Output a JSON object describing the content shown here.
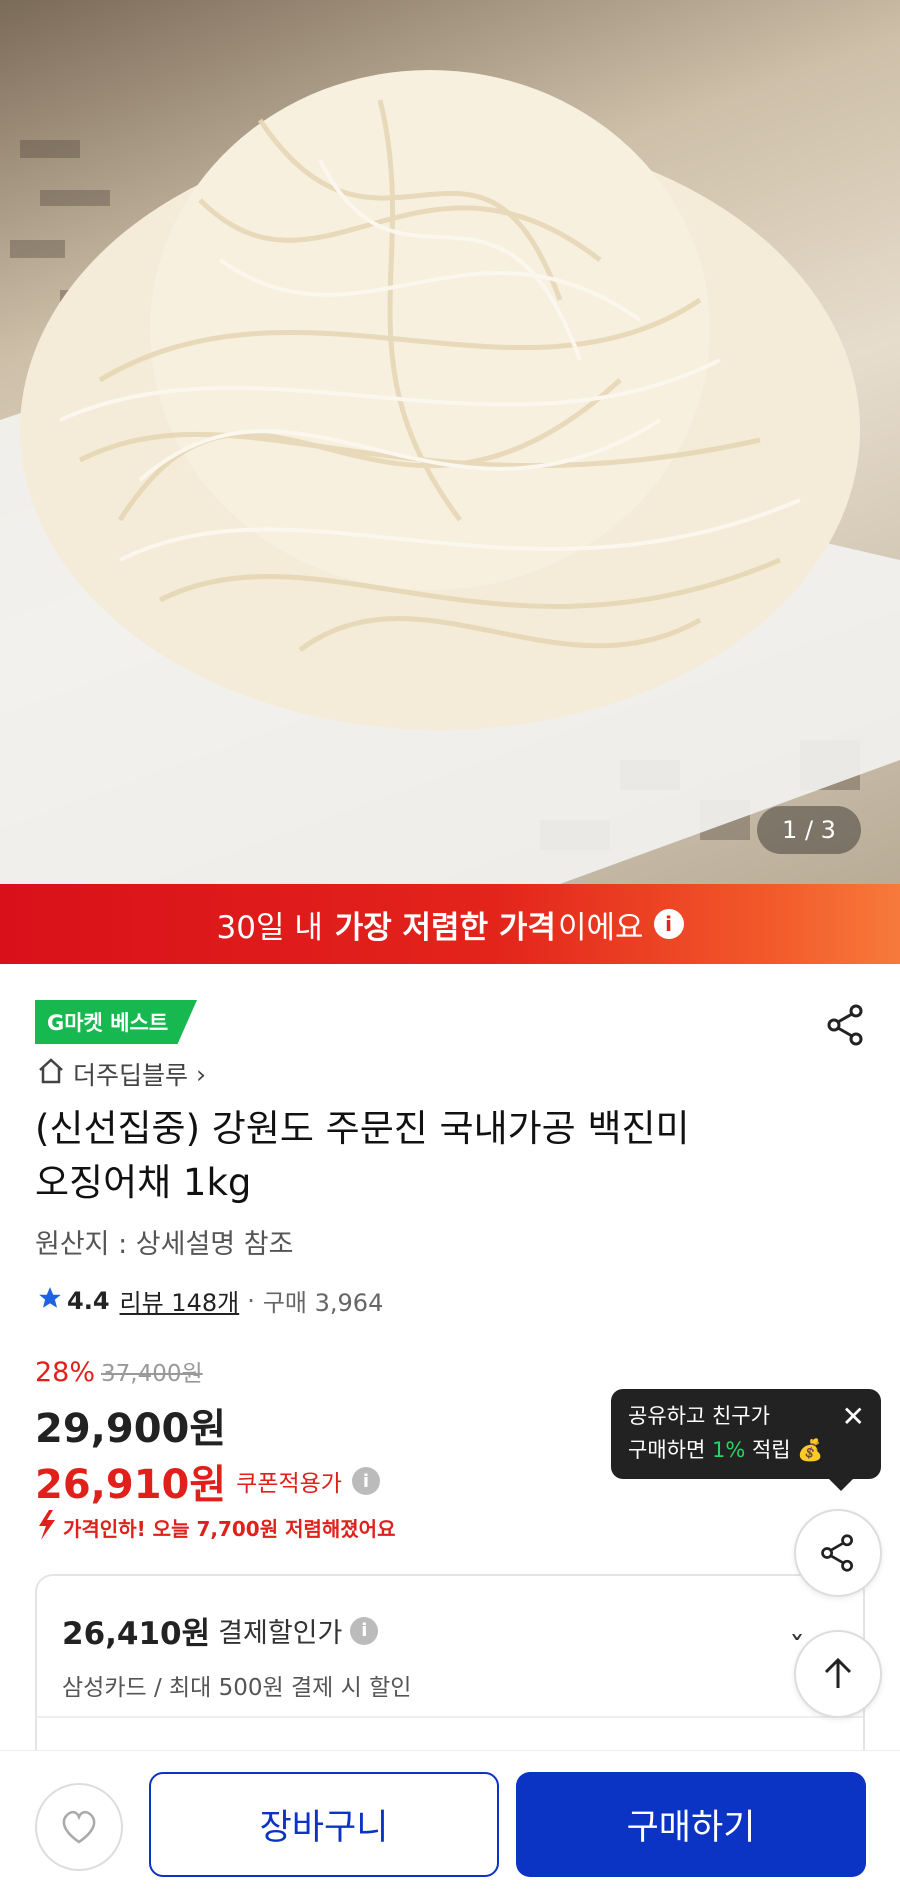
{
  "hero": {
    "counter": "1 / 3"
  },
  "promo": {
    "pre": "30일 내 ",
    "strong": "가장 저렴한 가격",
    "post": "이에요"
  },
  "badge": "G마켓 베스트",
  "store": {
    "name": "더주딥블루",
    "chevron": "›"
  },
  "product": {
    "title_line1": "(신선집중) 강원도 주문진 국내가공 백진미",
    "title_line2": "오징어채 1kg",
    "origin": "원산지 : 상세설명 참조"
  },
  "rating": {
    "score": "4.4",
    "reviews": "리뷰 148개",
    "sep": "·",
    "purchases": "구매 3,964"
  },
  "pricing": {
    "discount_rate": "28%",
    "original": "37,400원",
    "price": "29,900원",
    "coupon_price": "26,910원",
    "coupon_label": "쿠폰적용가",
    "price_drop": "가격인하! 오늘 7,700원 저렴해졌어요"
  },
  "tooltip": {
    "line1": "공유하고 친구가",
    "line2_pre": "구매하면 ",
    "line2_pct": "1%",
    "line2_post": " 적립"
  },
  "payment": {
    "price": "26,410원",
    "label": "결제할인가",
    "sub": "삼성카드 / 최대 500원 결제 시 할인"
  },
  "bottom": {
    "cart": "장바구니",
    "buy": "구매하기"
  },
  "colors": {
    "primary_blue": "#0b34c4",
    "red": "#e0201b",
    "badge_green": "#16b84f"
  }
}
